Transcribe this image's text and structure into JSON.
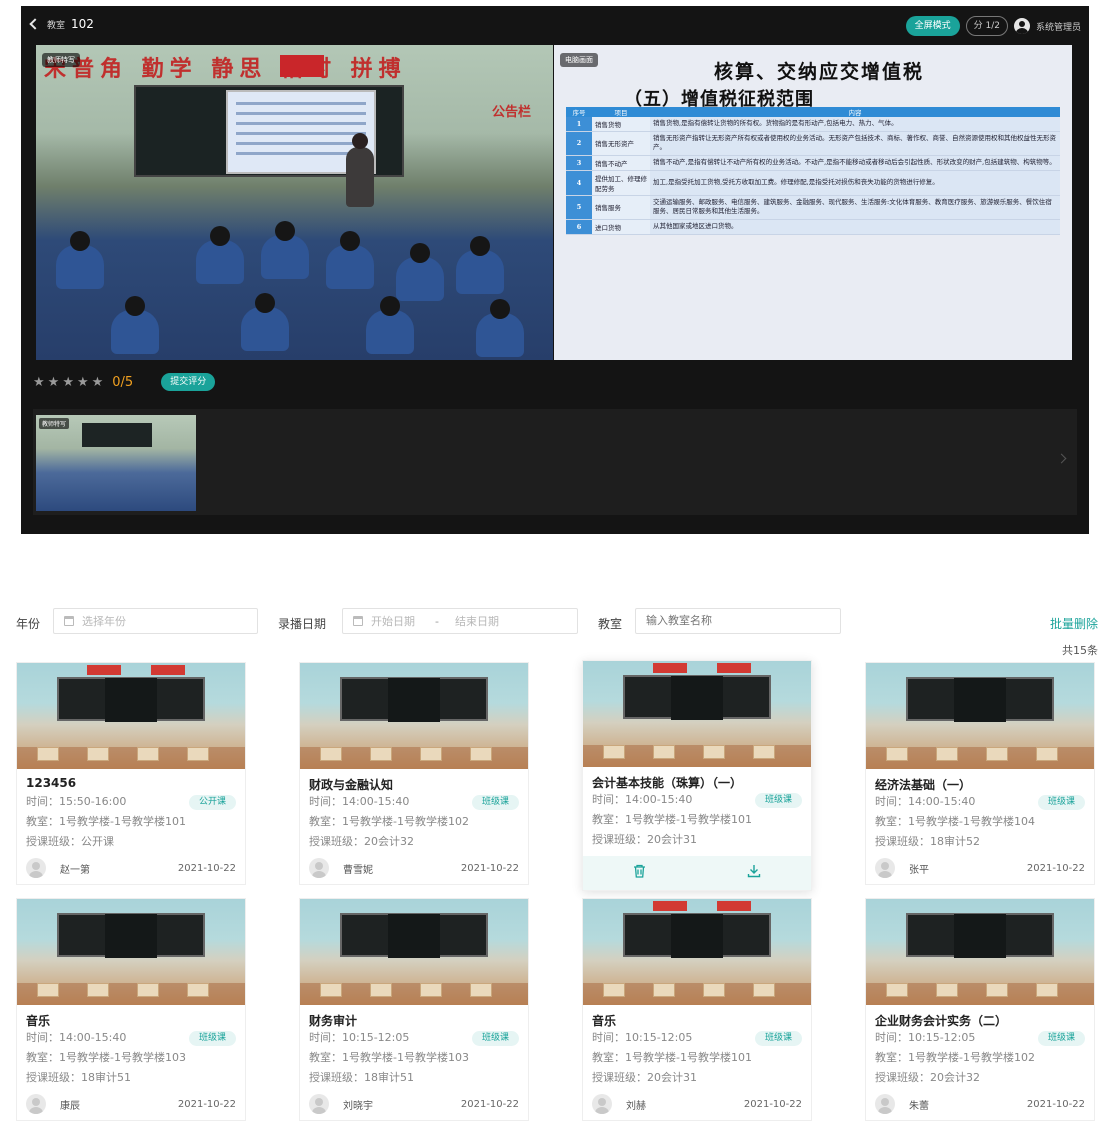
{
  "player": {
    "back": {
      "classroom_label": "教室",
      "room_no": "102"
    },
    "mode_button": "全屏模式",
    "layout_button": "分 1/2",
    "admin_name": "系统管理员",
    "left_video": {
      "tag": "教师特写",
      "banner": "宋普角 勤学  静思  惜时  拼搏",
      "notice": "公告栏"
    },
    "right_video": {
      "tag": "电脑画面",
      "title": "核算、交纳应交增值税",
      "subtitle": "（五）增值税征税范围",
      "table": {
        "headers": [
          "序号",
          "项目",
          "内容"
        ],
        "rows": [
          {
            "no": "1",
            "item": "销售货物",
            "content": "销售货物,是指有偿转让货物的所有权。货物指的是有形动产,包括电力、热力、气体。"
          },
          {
            "no": "2",
            "item": "销售无形资产",
            "content": "销售无形资产指转让无形资产所有权或者使用权的业务活动。无形资产包括技术、商标、著作权、商誉、自然资源使用权和其他权益性无形资产。"
          },
          {
            "no": "3",
            "item": "销售不动产",
            "content": "销售不动产,是指有偿转让不动产所有权的业务活动。不动产,是指不能移动或者移动后会引起性质、形状改变的财产,包括建筑物、构筑物等。"
          },
          {
            "no": "4",
            "item": "提供加工、修理修配劳务",
            "content": "加工,是指受托加工货物,受托方收取加工费。修理修配,是指受托对损伤和丧失功能的货物进行修复。"
          },
          {
            "no": "5",
            "item": "销售服务",
            "content": "交通运输服务、邮政服务、电信服务、建筑服务、金融服务、现代服务、生活服务:文化体育服务、教育医疗服务、旅游娱乐服务、餐饮住宿服务、居民日常服务和其他生活服务。"
          },
          {
            "no": "6",
            "item": "进口货物",
            "content": "从其他国家或地区进口货物。"
          }
        ]
      }
    },
    "rating": {
      "stars": [
        "★",
        "★",
        "★",
        "★",
        "★"
      ],
      "score": "0/5",
      "submit": "提交评分"
    },
    "thumbnail": {
      "tag": "教师特写"
    }
  },
  "filters": {
    "year": {
      "label": "年份",
      "placeholder": "选择年份"
    },
    "record_date": {
      "label": "录播日期",
      "start_placeholder": "开始日期",
      "separator": "-",
      "end_placeholder": "结束日期"
    },
    "classroom": {
      "label": "教室",
      "placeholder": "输入教室名称"
    },
    "batch_delete": "批量删除",
    "total": "共15条"
  },
  "cards": [
    {
      "title": "123456",
      "time": "时间：15:50-16:00",
      "badge": "公开课",
      "room": "教室：1号教学楼-1号教学楼101",
      "class": "授课班级：公开课",
      "teacher": "赵一第",
      "date": "2021-10-22"
    },
    {
      "title": "财政与金融认知",
      "time": "时间：14:00-15:40",
      "badge": "班级课",
      "room": "教室：1号教学楼-1号教学楼102",
      "class": "授课班级：20会计32",
      "teacher": "曹雪妮",
      "date": "2021-10-22"
    },
    {
      "title": "会计基本技能（珠算）（一）",
      "time": "时间：14:00-15:40",
      "badge": "班级课",
      "room": "教室：1号教学楼-1号教学楼101",
      "class": "授课班级：20会计31",
      "teacher": "",
      "date": ""
    },
    {
      "title": "经济法基础（一）",
      "time": "时间：14:00-15:40",
      "badge": "班级课",
      "room": "教室：1号教学楼-1号教学楼104",
      "class": "授课班级：18审计52",
      "teacher": "张平",
      "date": "2021-10-22"
    },
    {
      "title": "音乐",
      "time": "时间：14:00-15:40",
      "badge": "班级课",
      "room": "教室：1号教学楼-1号教学楼103",
      "class": "授课班级：18审计51",
      "teacher": "康辰",
      "date": "2021-10-22"
    },
    {
      "title": "财务审计",
      "time": "时间：10:15-12:05",
      "badge": "班级课",
      "room": "教室：1号教学楼-1号教学楼103",
      "class": "授课班级：18审计51",
      "teacher": "刘晓宇",
      "date": "2021-10-22"
    },
    {
      "title": "音乐",
      "time": "时间：10:15-12:05",
      "badge": "班级课",
      "room": "教室：1号教学楼-1号教学楼101",
      "class": "授课班级：20会计31",
      "teacher": "刘赫",
      "date": "2021-10-22"
    },
    {
      "title": "企业财务会计实务（二）",
      "time": "时间：10:15-12:05",
      "badge": "班级课",
      "room": "教室：1号教学楼-1号教学楼102",
      "class": "授课班级：20会计32",
      "teacher": "朱蕾",
      "date": "2021-10-22"
    }
  ],
  "hover_actions": {
    "delete_icon": "trash-icon",
    "download_icon": "download-icon"
  },
  "colors": {
    "accent": "#1aa39a",
    "star_active": "#f0a020",
    "player_bg": "#141414"
  }
}
